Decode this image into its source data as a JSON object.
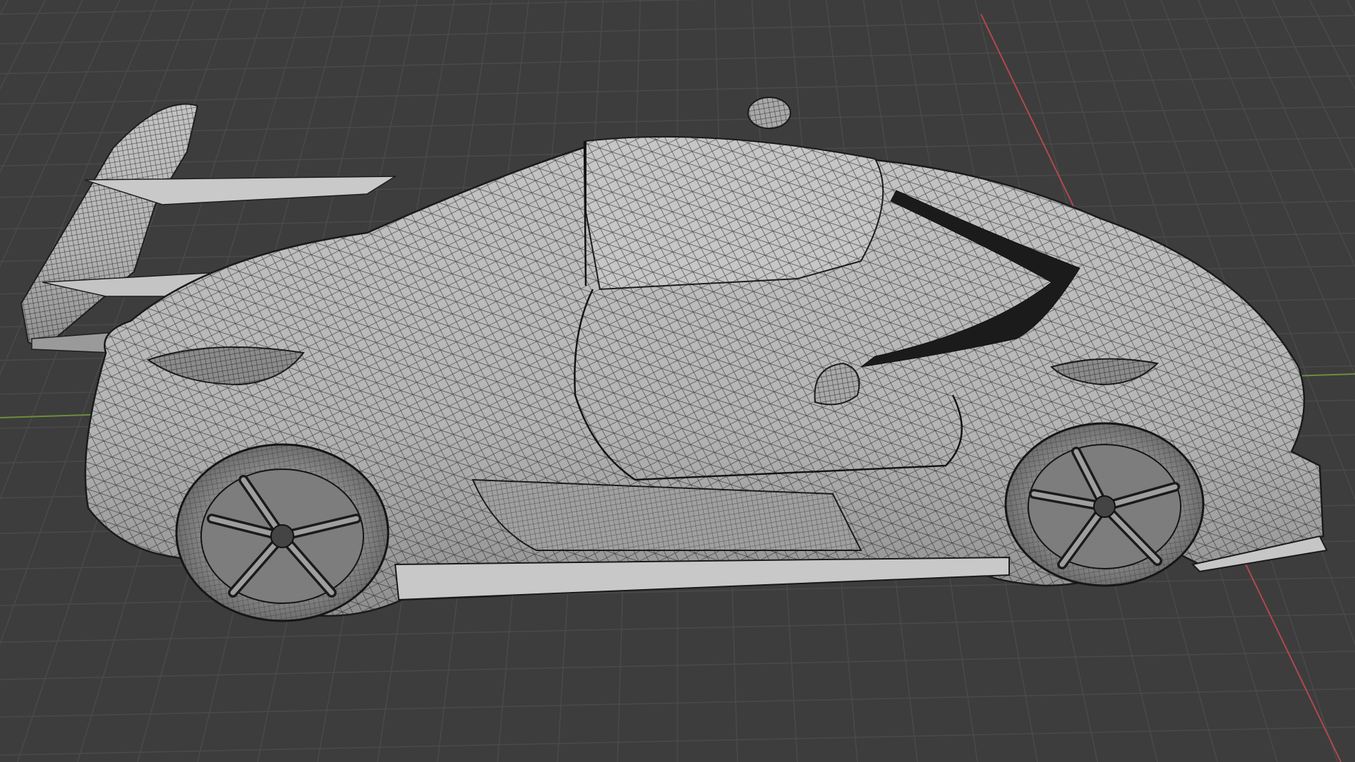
{
  "viewport": {
    "background": "#3d3d3d",
    "grid_line_color": "#4a4a4a",
    "x_axis_color": "#b0484f",
    "y_axis_color": "#6b8f3a",
    "view": "perspective"
  },
  "model": {
    "display_mode": "solid-wireframe",
    "surface_color": "#b9b9b9",
    "wire_color": "#222222",
    "shadow_color": "#6f6f6f",
    "parts": [
      "body",
      "roof",
      "rear-wing",
      "rear-wheel",
      "front-wheel",
      "side-mirror",
      "side-skirt",
      "front-splitter",
      "windshield",
      "headlight",
      "taillight",
      "roof-antenna"
    ]
  }
}
